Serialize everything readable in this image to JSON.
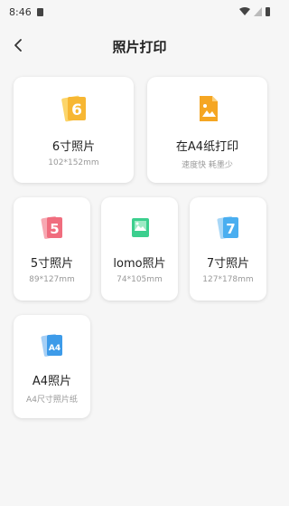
{
  "status_bar": {
    "time": "8:46"
  },
  "header": {
    "title": "照片打印"
  },
  "cards": [
    {
      "label": "6寸照片",
      "sub": "102*152mm",
      "icon": "photo-6-icon",
      "color": "#f7b733"
    },
    {
      "label": "在A4纸打印",
      "sub": "速度快 耗墨少",
      "icon": "image-file-icon",
      "color": "#f5a623"
    },
    {
      "label": "5寸照片",
      "sub": "89*127mm",
      "icon": "photo-5-icon",
      "color": "#f06d7e"
    },
    {
      "label": "lomo照片",
      "sub": "74*105mm",
      "icon": "lomo-photo-icon",
      "color": "#3ccf8e"
    },
    {
      "label": "7寸照片",
      "sub": "127*178mm",
      "icon": "photo-7-icon",
      "color": "#4aaef0"
    },
    {
      "label": "A4照片",
      "sub": "A4尺寸照片纸",
      "icon": "photo-a4-icon",
      "color": "#3d9be9"
    }
  ]
}
